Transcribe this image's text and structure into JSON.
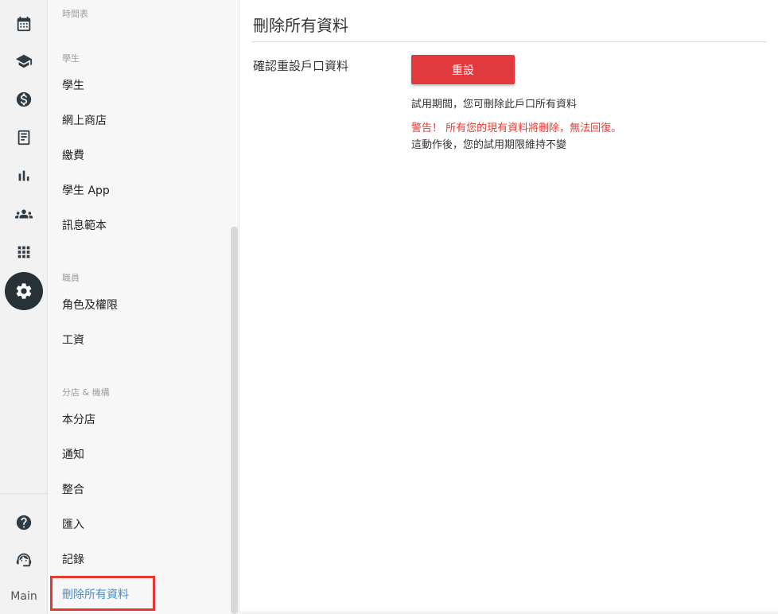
{
  "rail": {
    "icons": [
      "calendar-icon",
      "graduation-cap-icon",
      "dollar-icon",
      "receipt-icon",
      "bar-chart-icon",
      "people-icon",
      "apps-grid-icon",
      "gear-icon",
      "help-icon",
      "support-agent-icon"
    ],
    "active": "gear-icon",
    "main_label": "Main"
  },
  "menu": {
    "timetable_section": "時間表",
    "student_section": "學生",
    "student_items": [
      "學生",
      "網上商店",
      "繳費",
      "學生 App",
      "訊息範本"
    ],
    "staff_section": "職員",
    "staff_items": [
      "角色及權限",
      "工資"
    ],
    "branch_section": "分店 & 機構",
    "branch_items": [
      "本分店",
      "通知",
      "整合",
      "匯入",
      "記錄",
      "刪除所有資料"
    ],
    "active_item": "刪除所有資料"
  },
  "main": {
    "title": "刪除所有資料",
    "row_label": "確認重設戶口資料",
    "reset_button": "重設",
    "info_text": "試用期間，您可刪除此戶口所有資料",
    "warning_text": "警告！ 所有您的現有資料將刪除，無法回復。",
    "info_text2": "這動作後，您的試用期限維持不變"
  },
  "colors": {
    "accent": "#3d8fe0",
    "danger": "#e0393e",
    "warning": "#e53935",
    "rail_active_bg": "#263238"
  }
}
